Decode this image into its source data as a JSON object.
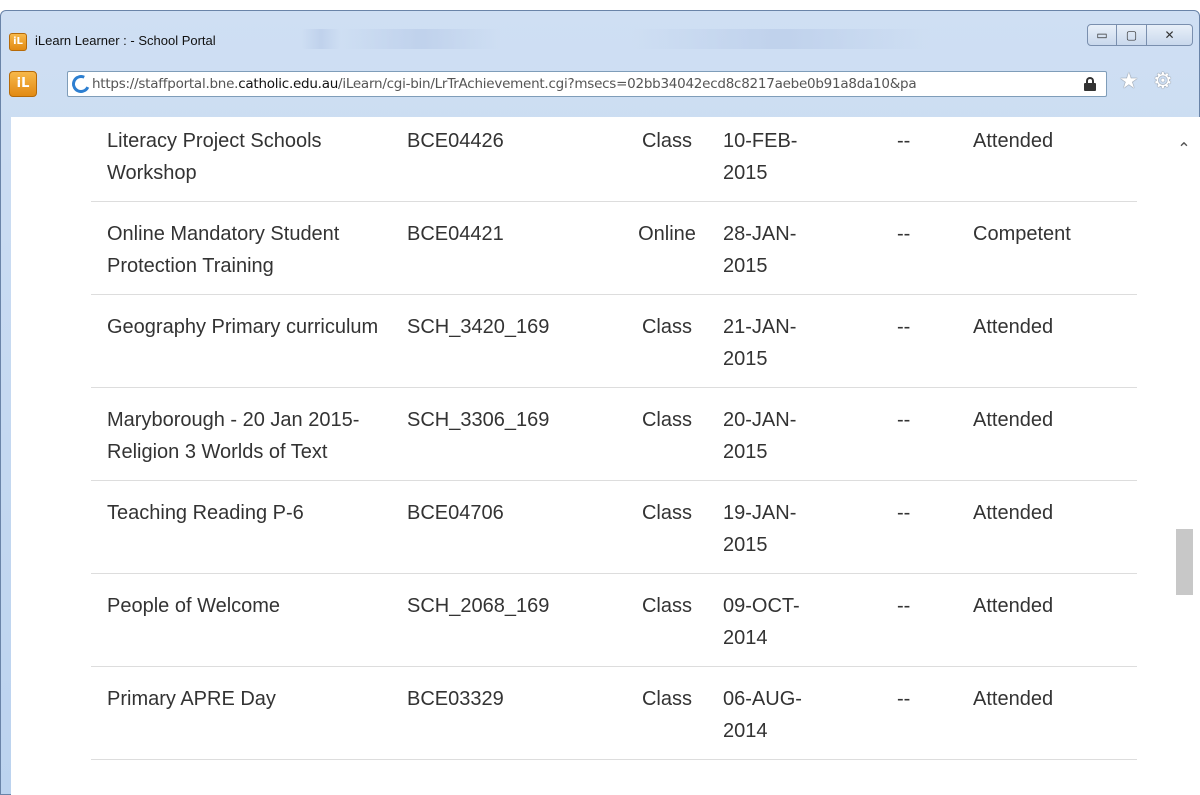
{
  "window": {
    "title": "iLearn Learner : - School Portal",
    "url_prefix": "https://staffportal.bne.",
    "url_domain": "catholic.edu.au",
    "url_suffix": "/iLearn/cgi-bin/LrTrAchievement.cgi?msecs=02bb34042ecd8c8217aebe0b91a8da10&pa",
    "controls": {
      "minimize": "▭",
      "maximize": "▢",
      "close": "✕"
    }
  },
  "toolbar": {
    "star": "★",
    "gear": "⚙"
  },
  "scrollbar": {
    "up_arrow": "⌃"
  },
  "rows": [
    {
      "title": "Literacy Project Schools Workshop",
      "code": "BCE04426",
      "type": "Class",
      "date": "10-FEB-2015",
      "score": "--",
      "status": "Attended"
    },
    {
      "title": "Online Mandatory Student Protection Training",
      "code": "BCE04421",
      "type": "Online",
      "date": "28-JAN-2015",
      "score": "--",
      "status": "Competent"
    },
    {
      "title": "Geography Primary curriculum",
      "code": "SCH_3420_169",
      "type": "Class",
      "date": "21-JAN-2015",
      "score": "--",
      "status": "Attended"
    },
    {
      "title": "Maryborough - 20 Jan 2015- Religion 3 Worlds of Text",
      "code": "SCH_3306_169",
      "type": "Class",
      "date": "20-JAN-2015",
      "score": "--",
      "status": "Attended"
    },
    {
      "title": "Teaching Reading P-6",
      "code": "BCE04706",
      "type": "Class",
      "date": "19-JAN-2015",
      "score": "--",
      "status": "Attended"
    },
    {
      "title": "People of Welcome",
      "code": "SCH_2068_169",
      "type": "Class",
      "date": "09-OCT-2014",
      "score": "--",
      "status": "Attended"
    },
    {
      "title": "Primary APRE Day",
      "code": "BCE03329",
      "type": "Class",
      "date": "06-AUG-2014",
      "score": "--",
      "status": "Attended"
    }
  ]
}
